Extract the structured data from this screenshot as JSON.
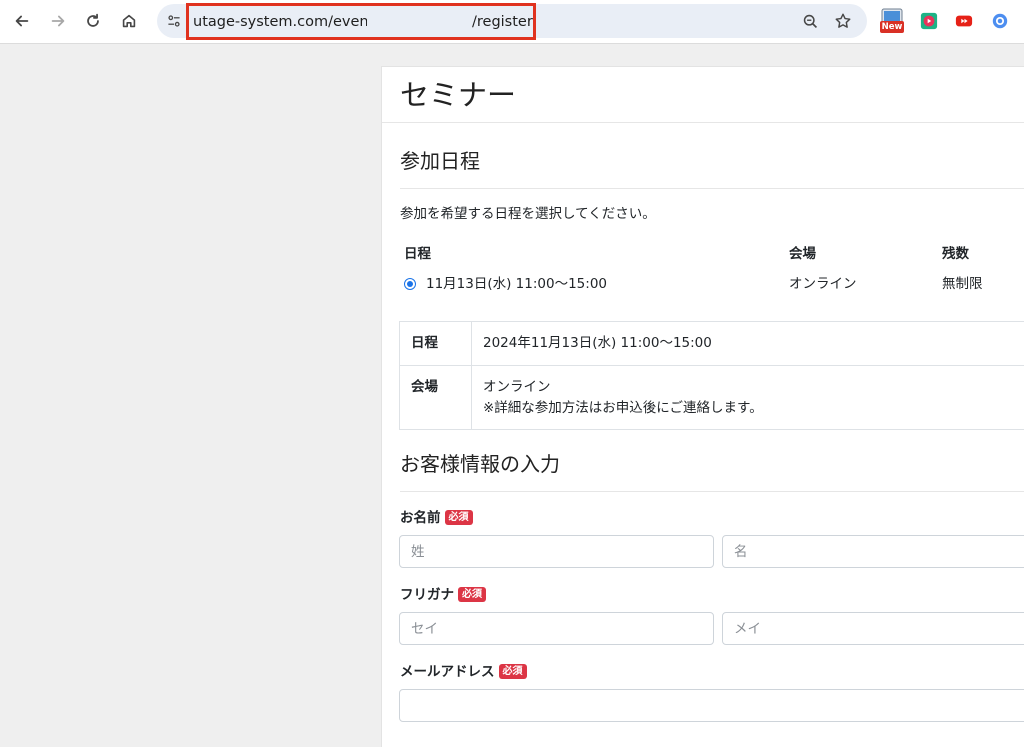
{
  "browser": {
    "url_visible": "utage-system.com/event/a",
    "url_suffix": "/register",
    "extension_badge": "New"
  },
  "page": {
    "title": "セミナー",
    "schedule_section": {
      "heading": "参加日程",
      "instruction": "参加を希望する日程を選択してください。",
      "columns": [
        "日程",
        "会場",
        "残数"
      ],
      "options": [
        {
          "date": "11月13日(水) 11:00〜15:00",
          "venue": "オンライン",
          "remaining": "無制限",
          "selected": true
        }
      ]
    },
    "details": {
      "date_label": "日程",
      "date_value": "2024年11月13日(水) 11:00〜15:00",
      "venue_label": "会場",
      "venue_value": "オンライン",
      "venue_note": "※詳細な参加方法はお申込後にご連絡します。"
    },
    "customer_section": {
      "heading": "お客様情報の入力",
      "required_badge": "必須",
      "name": {
        "label": "お名前",
        "last_placeholder": "姓",
        "first_placeholder": "名",
        "last_value": "",
        "first_value": ""
      },
      "furigana": {
        "label": "フリガナ",
        "last_placeholder": "セイ",
        "first_placeholder": "メイ",
        "last_value": "",
        "first_value": ""
      },
      "email": {
        "label": "メールアドレス",
        "placeholder": "",
        "value": ""
      }
    }
  },
  "colors": {
    "highlight": "#e0321f",
    "required_badge": "#dc3545",
    "radio": "#1a73e8"
  }
}
